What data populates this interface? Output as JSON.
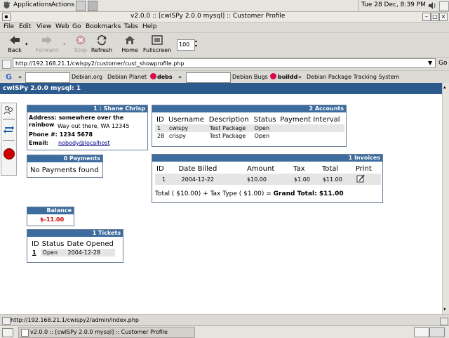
{
  "panel": {
    "applications": "Applications",
    "actions": "Actions",
    "clock": "Tue 28 Dec,  8:39 PM"
  },
  "window": {
    "title": "v2.0.0 :: [cwISPy 2.0.0 mysql] :: Customer Profile"
  },
  "menu": {
    "items": [
      "File",
      "Edit",
      "View",
      "Web",
      "Go",
      "Bookmarks",
      "Tabs",
      "Help"
    ]
  },
  "toolbar": {
    "back": "Back",
    "forward": "Forward",
    "stop": "Stop",
    "refresh": "Refresh",
    "home": "Home",
    "fullscreen": "Fullscreen",
    "zoom": "100"
  },
  "urlbar": {
    "url": "http://192.168.21.1/cwispy2/customer/cust_showprofile.php",
    "go": "Go"
  },
  "bookmarks": {
    "debian_org": "Debian.org",
    "debian_planet": "Debian Planet",
    "debs": "debs",
    "debian_bugs": "Debian Bugs",
    "buildd": "buildd",
    "dpts": "Debian Package Tracking System",
    "chevron": "«"
  },
  "app": {
    "title": "cwISPy 2.0.0 mysql: 1"
  },
  "customer": {
    "header": "1 : Shane Chrisp",
    "address_label": "Address:",
    "address_line1": "somewhere over the rainbow",
    "address_line2": "Way out there, WA 12345",
    "phone_label": "Phone #:",
    "phone": "1234 5678",
    "email_label": "Email:",
    "email": "nobody@localhost"
  },
  "accounts": {
    "header": "2 Accounts",
    "columns": [
      "ID",
      "Username",
      "Description",
      "Status",
      "Payment Interval"
    ],
    "rows": [
      {
        "id": "1",
        "username": "cwispy",
        "description": "Test Package",
        "status": "Open",
        "interval": ""
      },
      {
        "id": "28",
        "username": "crispy",
        "description": "Test Package",
        "status": "Open",
        "interval": ""
      }
    ]
  },
  "payments": {
    "header": "0 Payments",
    "empty": "No Payments found"
  },
  "invoices": {
    "header": "1 Invoices",
    "columns": [
      "ID",
      "Date Billed",
      "Amount",
      "Tax",
      "Total",
      "Print"
    ],
    "rows": [
      {
        "id": "1",
        "date": "2004-12-22",
        "amount": "$10.00",
        "tax": "$1.00",
        "total": "$11.00"
      }
    ],
    "total_prefix": "Total ( $10.00) + Tax Type ( $1.00) = ",
    "grand_total": "Grand Total: $11.00"
  },
  "balance": {
    "header": "Balance",
    "value": "$-11.00"
  },
  "tickets": {
    "header": "1 Tickets",
    "columns": [
      "ID",
      "Status",
      "Date Opened"
    ],
    "rows": [
      {
        "id": "1",
        "status": "Open",
        "date": "2004-12-28"
      }
    ]
  },
  "status": {
    "url": "http://192.168.21.1/cwispy2/admin/index.php"
  },
  "taskbar": {
    "task": "v2.0.0 :: [cwISPy 2.0.0 mysql] :: Customer Profile"
  },
  "colors": {
    "appbar": "#2d5a8c",
    "box_header": "#3d6d9e",
    "balance": "#cc0000",
    "link": "#00008b"
  }
}
